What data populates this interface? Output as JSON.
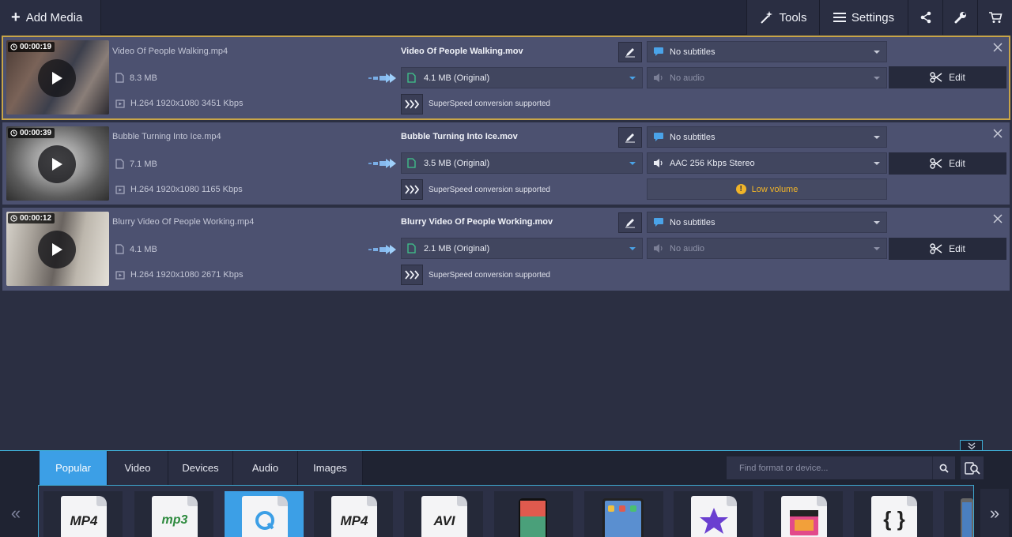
{
  "toolbar": {
    "add_media": "Add Media",
    "tools": "Tools",
    "settings": "Settings"
  },
  "files": [
    {
      "duration": "00:00:19",
      "source_name": "Video Of People Walking.mp4",
      "source_size": "8.3 MB",
      "source_codec": "H.264 1920x1080 3451 Kbps",
      "output_name": "Video Of People Walking.mov",
      "output_size": "4.1 MB (Original)",
      "speed_text": "SuperSpeed conversion supported",
      "subtitles": "No subtitles",
      "audio": "No audio",
      "edit": "Edit",
      "selected": true
    },
    {
      "duration": "00:00:39",
      "source_name": "Bubble Turning Into Ice.mp4",
      "source_size": "7.1 MB",
      "source_codec": "H.264 1920x1080 1165 Kbps",
      "output_name": "Bubble Turning Into Ice.mov",
      "output_size": "3.5 MB (Original)",
      "speed_text": "SuperSpeed conversion supported",
      "subtitles": "No subtitles",
      "audio": "AAC 256 Kbps Stereo",
      "warning": "Low volume",
      "edit": "Edit"
    },
    {
      "duration": "00:00:12",
      "source_name": "Blurry Video Of People Working.mp4",
      "source_size": "4.1 MB",
      "source_codec": "H.264 1920x1080 2671 Kbps",
      "output_name": "Blurry Video Of People Working.mov",
      "output_size": "2.1 MB (Original)",
      "speed_text": "SuperSpeed conversion supported",
      "subtitles": "No subtitles",
      "audio": "No audio",
      "edit": "Edit"
    }
  ],
  "bottom": {
    "tabs": [
      "Popular",
      "Video",
      "Devices",
      "Audio",
      "Images"
    ],
    "active_tab": "Popular",
    "search_placeholder": "Find format or device...",
    "formats": [
      {
        "icon": "mp4-icon",
        "label": "MP4"
      },
      {
        "icon": "mp3-icon",
        "label": "mp3"
      },
      {
        "icon": "quicktime-icon",
        "label": ""
      },
      {
        "icon": "mp4-icon",
        "label": "MP4"
      },
      {
        "icon": "avi-icon",
        "label": "AVI"
      },
      {
        "icon": "iphone-icon",
        "label": ""
      },
      {
        "icon": "ipad-icon",
        "label": ""
      },
      {
        "icon": "imovie-icon",
        "label": ""
      },
      {
        "icon": "final-cut-icon",
        "label": ""
      },
      {
        "icon": "code-icon",
        "label": ""
      },
      {
        "icon": "device-icon",
        "label": ""
      }
    ]
  },
  "colors": {
    "accent": "#3c9fe6",
    "selection": "#c8a548",
    "warning": "#f0b429"
  }
}
